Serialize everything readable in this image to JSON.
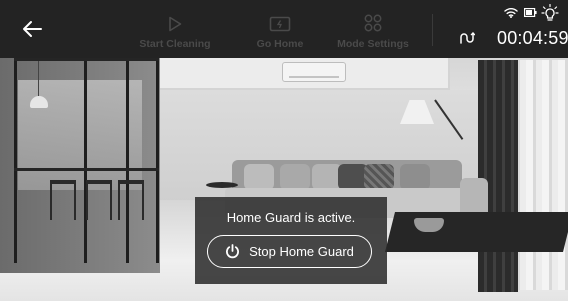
{
  "topbar": {
    "back_icon": "arrow-left-icon",
    "actions": [
      {
        "label": "Start Cleaning",
        "icon": "play-outline-icon",
        "enabled": false
      },
      {
        "label": "Go Home",
        "icon": "charging-dock-icon",
        "enabled": false
      },
      {
        "label": "Mode Settings",
        "icon": "four-circles-icon",
        "enabled": false
      }
    ],
    "switch_icon": "switch-camera-icon",
    "timer": "00:04:59",
    "status_icons": [
      "wifi-icon",
      "battery-icon",
      "light-bulb-icon"
    ]
  },
  "camera_view": {
    "description_icon": "live-camera-feed"
  },
  "guard_card": {
    "message": "Home Guard is active.",
    "button_label": "Stop Home Guard",
    "button_icon": "power-icon"
  },
  "colors": {
    "topbar_bg": "#232323",
    "disabled_text": "#4a4a4a",
    "overlay_bg": "#2a2a2a",
    "text": "#ffffff"
  }
}
